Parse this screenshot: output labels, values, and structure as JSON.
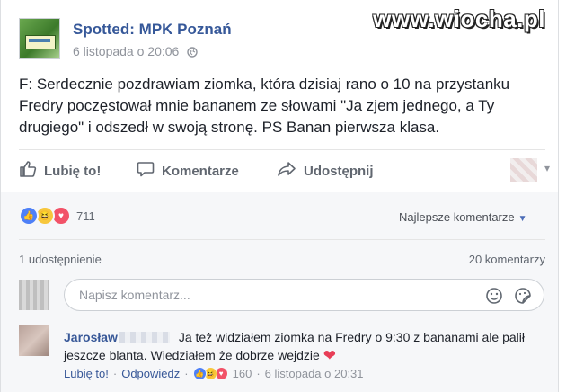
{
  "header": {
    "page_name": "Spotted: MPK Poznań",
    "date": "6 listopada o 20:06",
    "watermark": "www.wiocha.pl"
  },
  "post": {
    "text": "F: Serdecznie pozdrawiam ziomka, która dzisiaj rano o 10 na przystanku Fredry poczęstował mnie bananem ze słowami \"Ja zjem jednego, a Ty drugiego\" i odszedł w swoją stronę. PS Banan pierwsza klasa."
  },
  "actions": {
    "like": "Lubię to!",
    "comment": "Komentarze",
    "share": "Udostępnij"
  },
  "reactions": {
    "count": "711",
    "sort_label": "Najlepsze komentarze"
  },
  "stats": {
    "shares": "1 udostępnienie",
    "comments": "20 komentarzy"
  },
  "compose": {
    "placeholder": "Napisz komentarz..."
  },
  "comment": {
    "author": "Jarosław",
    "text": "Ja też widziałem ziomka na Fredry o 9:30 z bananami ale palił jeszcze blanta. Wiedziałem że dobrze wejdzie",
    "like": "Lubię to!",
    "reply": "Odpowiedz",
    "reaction_count": "160",
    "time": "6 listopada o 20:31"
  },
  "icons": [
    "globe-icon",
    "like-icon",
    "comment-icon",
    "share-icon",
    "emoji-icon",
    "sticker-icon",
    "heart-icon"
  ],
  "colors": {
    "link": "#365899",
    "accent": "#4e80f7",
    "love": "#f25268",
    "haha": "#f7c73d"
  }
}
